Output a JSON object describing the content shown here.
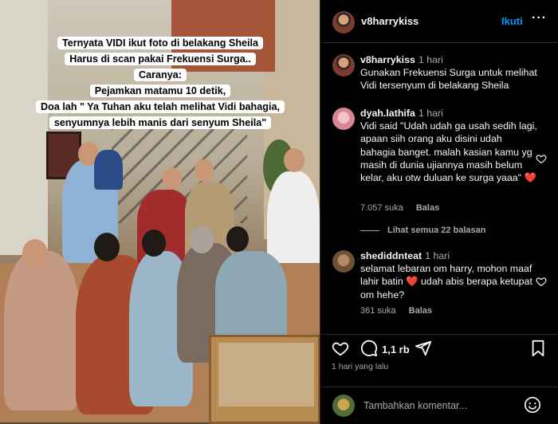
{
  "post": {
    "caption_lines": [
      "Ternyata VIDI ikut foto di belakang Sheila",
      "Harus di scan pakai Frekuensi Surga..",
      "Caranya:",
      "Pejamkan matamu 10 detik,",
      "Doa lah \" Ya Tuhan aku telah melihat Vidi bahagia,",
      "senyumnya lebih manis dari senyum Sheila\""
    ]
  },
  "header": {
    "username": "v8harrykiss",
    "follow_label": "Ikuti",
    "more_label": "···"
  },
  "owner_comment": {
    "username": "v8harrykiss",
    "time": "1 hari",
    "text": "Gunakan Frekuensi Surga untuk melihat Vidi tersenyum  di belakang Sheila"
  },
  "comments": [
    {
      "username": "dyah.lathifa",
      "time": "1 hari",
      "text": "Vidi said \"Udah udah ga usah sedih lagi, apaan siih orang aku disini udah bahagia banget. malah kasian kamu yg masih di dunia ujiannya masih belum kelar, aku otw duluan ke surga yaaa\" ❤️",
      "likes": "7.057 suka",
      "reply_label": "Balas"
    },
    {
      "username": "shediddnteat",
      "time": "1 hari",
      "text": "selamat lebaran om harry, mohon maaf lahir batin ❤️ udah abis berapa ketupat om hehe?",
      "likes": "361 suka",
      "reply_label": "Balas"
    }
  ],
  "view_replies_label": "Lihat semua 22 balasan",
  "actions": {
    "comment_count": "1,1 rb",
    "date": "1 hari yang lalu"
  },
  "composer": {
    "placeholder": "Tambahkan komentar..."
  },
  "colors": {
    "accent": "#0095f6",
    "background": "#000000",
    "muted": "#a8a8a8",
    "heart": "#ff3040"
  },
  "icons": [
    "heart-icon",
    "comment-icon",
    "share-icon",
    "bookmark-icon",
    "emoji-icon",
    "more-icon"
  ]
}
